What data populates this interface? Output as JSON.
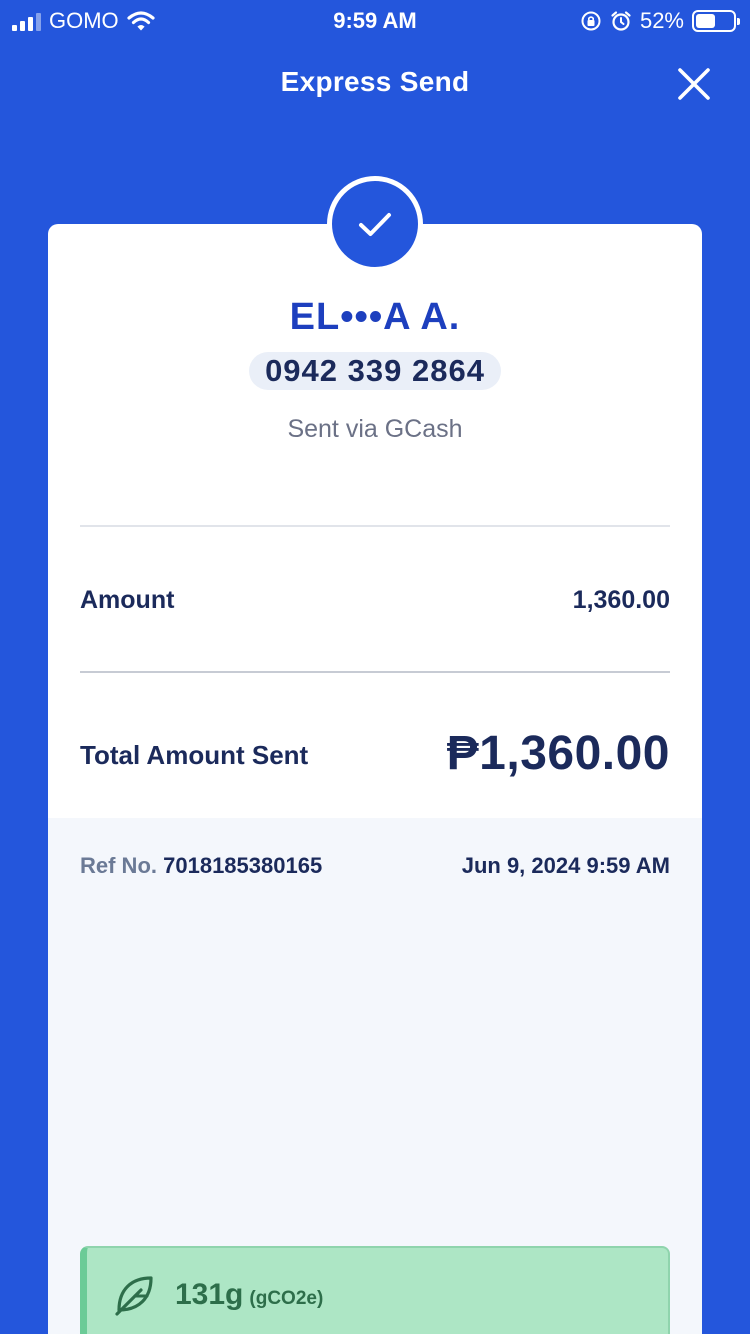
{
  "status_bar": {
    "carrier": "GOMO",
    "time": "9:59 AM",
    "battery": "52%",
    "battery_level": 0.52
  },
  "header": {
    "title": "Express Send",
    "close_icon": "close-icon"
  },
  "receipt": {
    "status_icon": "checkmark-icon",
    "recipient_name": "EL•••A A.",
    "recipient_number": "0942 339 2864",
    "sent_via": "Sent via GCash",
    "amount_label": "Amount",
    "amount_value": "1,360.00",
    "total_label": "Total Amount Sent",
    "total_value": "₱1,360.00"
  },
  "details": {
    "ref_label": "Ref No.",
    "ref_value": "7018185380165",
    "date": "Jun 9, 2024 9:59 AM"
  },
  "eco": {
    "icon": "leaf-icon",
    "value": "131g",
    "unit": "(gCO2e)"
  },
  "colors": {
    "primary": "#2456dc",
    "name_blue": "#1d3fbe",
    "text_dark": "#1b2a5b",
    "eco_bg": "#ade6c5"
  }
}
